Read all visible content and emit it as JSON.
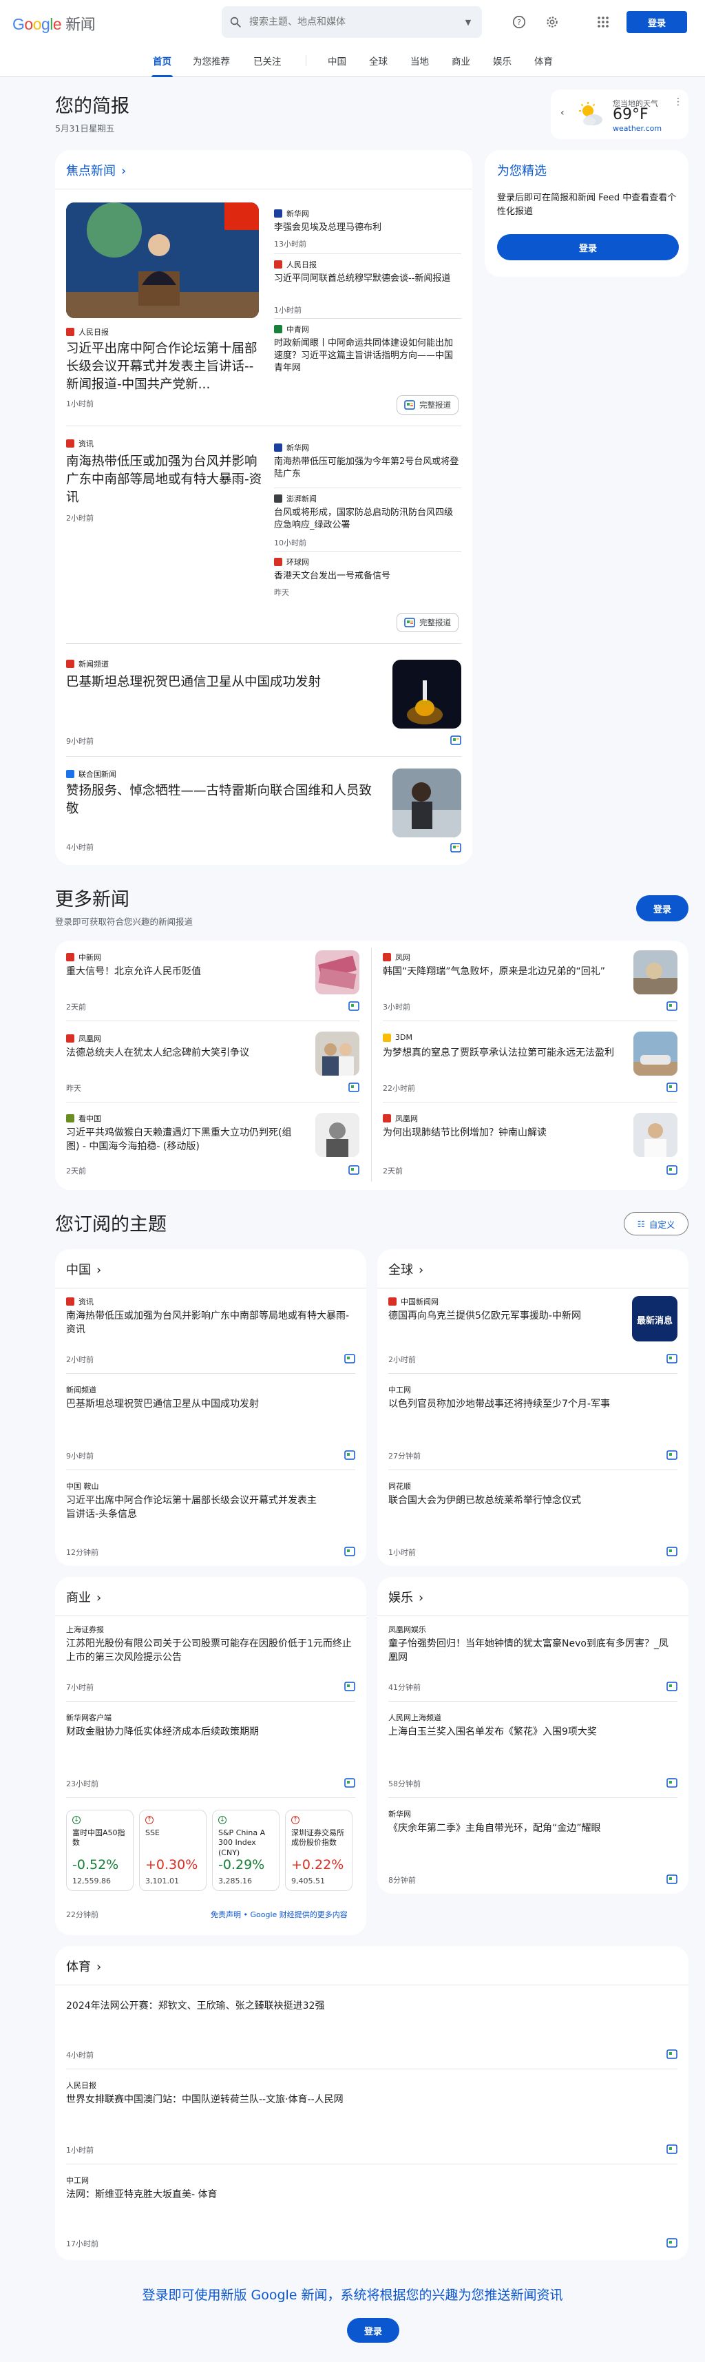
{
  "header": {
    "logo": "Google",
    "product": "新闻",
    "search_placeholder": "搜索主题、地点和媒体",
    "signin": "登录"
  },
  "nav": {
    "tabs": [
      "首页",
      "为您推荐",
      "已关注",
      "中国",
      "全球",
      "当地",
      "商业",
      "娱乐",
      "体育"
    ]
  },
  "briefing": {
    "title": "您的简报",
    "date": "5月31日星期五"
  },
  "weather": {
    "location": "您当地的天气",
    "temp": "69°F",
    "source": "weather.com"
  },
  "headlines": {
    "section": "焦点新闻",
    "cluster1": {
      "main": {
        "source": "人民日报",
        "title": "习近平出席中阿合作论坛第十届部长级会议开幕式并发表主旨讲话--新闻报道-中国共产党新...",
        "time": "1小时前"
      },
      "side": [
        {
          "source": "新华网",
          "title": "李强会见埃及总理马德布利",
          "time": "13小时前"
        },
        {
          "source": "人民日报",
          "title": "习近平同阿联酋总统穆罕默德会谈--新闻报道",
          "time": "1小时前"
        },
        {
          "source": "中青网",
          "title": "时政新闻眼丨中阿命运共同体建设如何能出加速度？习近平这篇主旨讲话指明方向——中国青年网",
          "time": ""
        }
      ],
      "full": "完整报道"
    },
    "cluster2": {
      "main": {
        "source": "资讯",
        "title": "南海热带低压或加强为台风并影响广东中南部等局地或有特大暴雨-资讯",
        "time": "2小时前"
      },
      "side": [
        {
          "source": "新华网",
          "title": "南海热带低压可能加强为今年第2号台风或将登陆广东",
          "time": ""
        },
        {
          "source": "澎湃新闻",
          "title": "台风或将形成，国家防总启动防汛防台风四级应急响应_绿政公署",
          "time": "10小时前"
        },
        {
          "source": "环球网",
          "title": "香港天文台发出一号戒备信号",
          "time": "昨天"
        }
      ],
      "full": "完整报道"
    },
    "single1": {
      "source": "新闻频道",
      "title": "巴基斯坦总理祝贺巴通信卫星从中国成功发射",
      "time": "9小时前"
    },
    "single2": {
      "source": "联合国新闻",
      "title": "赞扬服务、悼念牺牲——古特雷斯向联合国维和人员致敬",
      "time": "4小时前"
    }
  },
  "picks": {
    "title": "为您精选",
    "desc": "登录后即可在简报和新闻 Feed 中查看查看个性化报道",
    "btn": "登录"
  },
  "more": {
    "title": "更多新闻",
    "sub": "登录即可获取符合您兴趣的新闻报道",
    "btn": "登录",
    "items": [
      {
        "source": "中新网",
        "title": "重大信号！北京允许人民币贬值",
        "time": "2天前"
      },
      {
        "source": "凤网",
        "title": "韩国“天降翔瑞”气急败坏，原来是北边兄弟的“回礼”",
        "time": "3小时前"
      },
      {
        "source": "凤凰网",
        "title": "法德总统夫人在犹太人纪念碑前大笑引争议",
        "time": "昨天"
      },
      {
        "source": "3DM",
        "title": "为梦想真的窒息了贾跃亭承认法拉第可能永远无法盈利",
        "time": "22小时前"
      },
      {
        "source": "看中国",
        "title": "习近平共鸡做猴白天赖遭遇灯下黑重大立功仍判死(组图) - 中国海今海拍稳- (移动版)",
        "time": "2天前"
      },
      {
        "source": "凤凰网",
        "title": "为何出现肺结节比例增加？钟南山解读",
        "time": "2天前"
      }
    ]
  },
  "topics": {
    "title": "您订阅的主题",
    "customize": "自定义",
    "china": {
      "title": "中国",
      "items": [
        {
          "source": "资讯",
          "title": "南海热带低压或加强为台风并影响广东中南部等局地或有特大暴雨-资讯",
          "time": "2小时前"
        },
        {
          "source": "新闻频道",
          "title": "巴基斯坦总理祝贺巴通信卫星从中国成功发射",
          "time": "9小时前"
        },
        {
          "source": "中国 鞍山",
          "title": "习近平出席中阿合作论坛第十届部长级会议开幕式并发表主旨讲话-头条信息",
          "time": "12分钟前"
        }
      ]
    },
    "world": {
      "title": "全球",
      "items": [
        {
          "source": "中国新闻网",
          "title": "德国再向乌克兰提供5亿欧元军事援助-中新网",
          "time": "2小时前"
        },
        {
          "source": "中工网",
          "title": "以色列官员称加沙地带战事还将持续至少7个月-军事",
          "time": "27分钟前"
        },
        {
          "source": "同花顺",
          "title": "联合国大会为伊朗已故总统莱希举行悼念仪式",
          "time": "1小时前"
        }
      ]
    },
    "business": {
      "title": "商业",
      "items": [
        {
          "source": "上海证券报",
          "title": "江苏阳光股份有限公司关于公司股票可能存在因股价低于1元而终止上市的第三次风险提示公告",
          "time": "7小时前"
        },
        {
          "source": "新华网客户端",
          "title": "财政金融协力降低实体经济成本后续政策期期",
          "time": "23小时前"
        }
      ],
      "stocks": [
        {
          "name": "富时中国A50指数",
          "pct": "-0.52%",
          "price": "12,559.86",
          "dir": "down"
        },
        {
          "name": "SSE",
          "pct": "+0.30%",
          "price": "3,101.01",
          "dir": "up"
        },
        {
          "name": "S&P China A 300 Index (CNY)",
          "pct": "-0.29%",
          "price": "3,285.16",
          "dir": "down"
        },
        {
          "name": "深圳证券交易所成份股价指数",
          "pct": "+0.22%",
          "price": "9,405.51",
          "dir": "up"
        }
      ],
      "stock_time": "22分钟前",
      "disclaimer": "免责声明 • Google 财经提供的更多内容"
    },
    "ent": {
      "title": "娱乐",
      "items": [
        {
          "source": "凤凰网娱乐",
          "title": "童子怡强势回归！当年她钟情的犹太富豪Nevo到底有多厉害？_凤凰网",
          "time": "41分钟前"
        },
        {
          "source": "人民网上海频道",
          "title": "上海白玉兰奖入围名单发布《繁花》入围9项大奖",
          "time": "58分钟前"
        },
        {
          "source": "新华网",
          "title": "《庆余年第二季》主角自带光环，配角“金边”耀眼",
          "time": "8分钟前"
        }
      ]
    },
    "sports": {
      "title": "体育",
      "items": [
        {
          "source": "",
          "title": "2024年法网公开赛：郑钦文、王欣瑜、张之臻联袂挺进32强",
          "time": "4小时前"
        },
        {
          "source": "人民日报",
          "title": "世界女排联赛中国澳门站：中国队逆转荷兰队--文旅·体育--人民网",
          "time": "1小时前"
        },
        {
          "source": "中工网",
          "title": "法网：斯维亚特克胜大坂直美- 体育",
          "time": "17小时前"
        }
      ]
    }
  },
  "footer": {
    "text": "登录即可使用新版 Google 新闻，系统将根据您的兴趣为您推送新闻资讯",
    "btn": "登录"
  }
}
